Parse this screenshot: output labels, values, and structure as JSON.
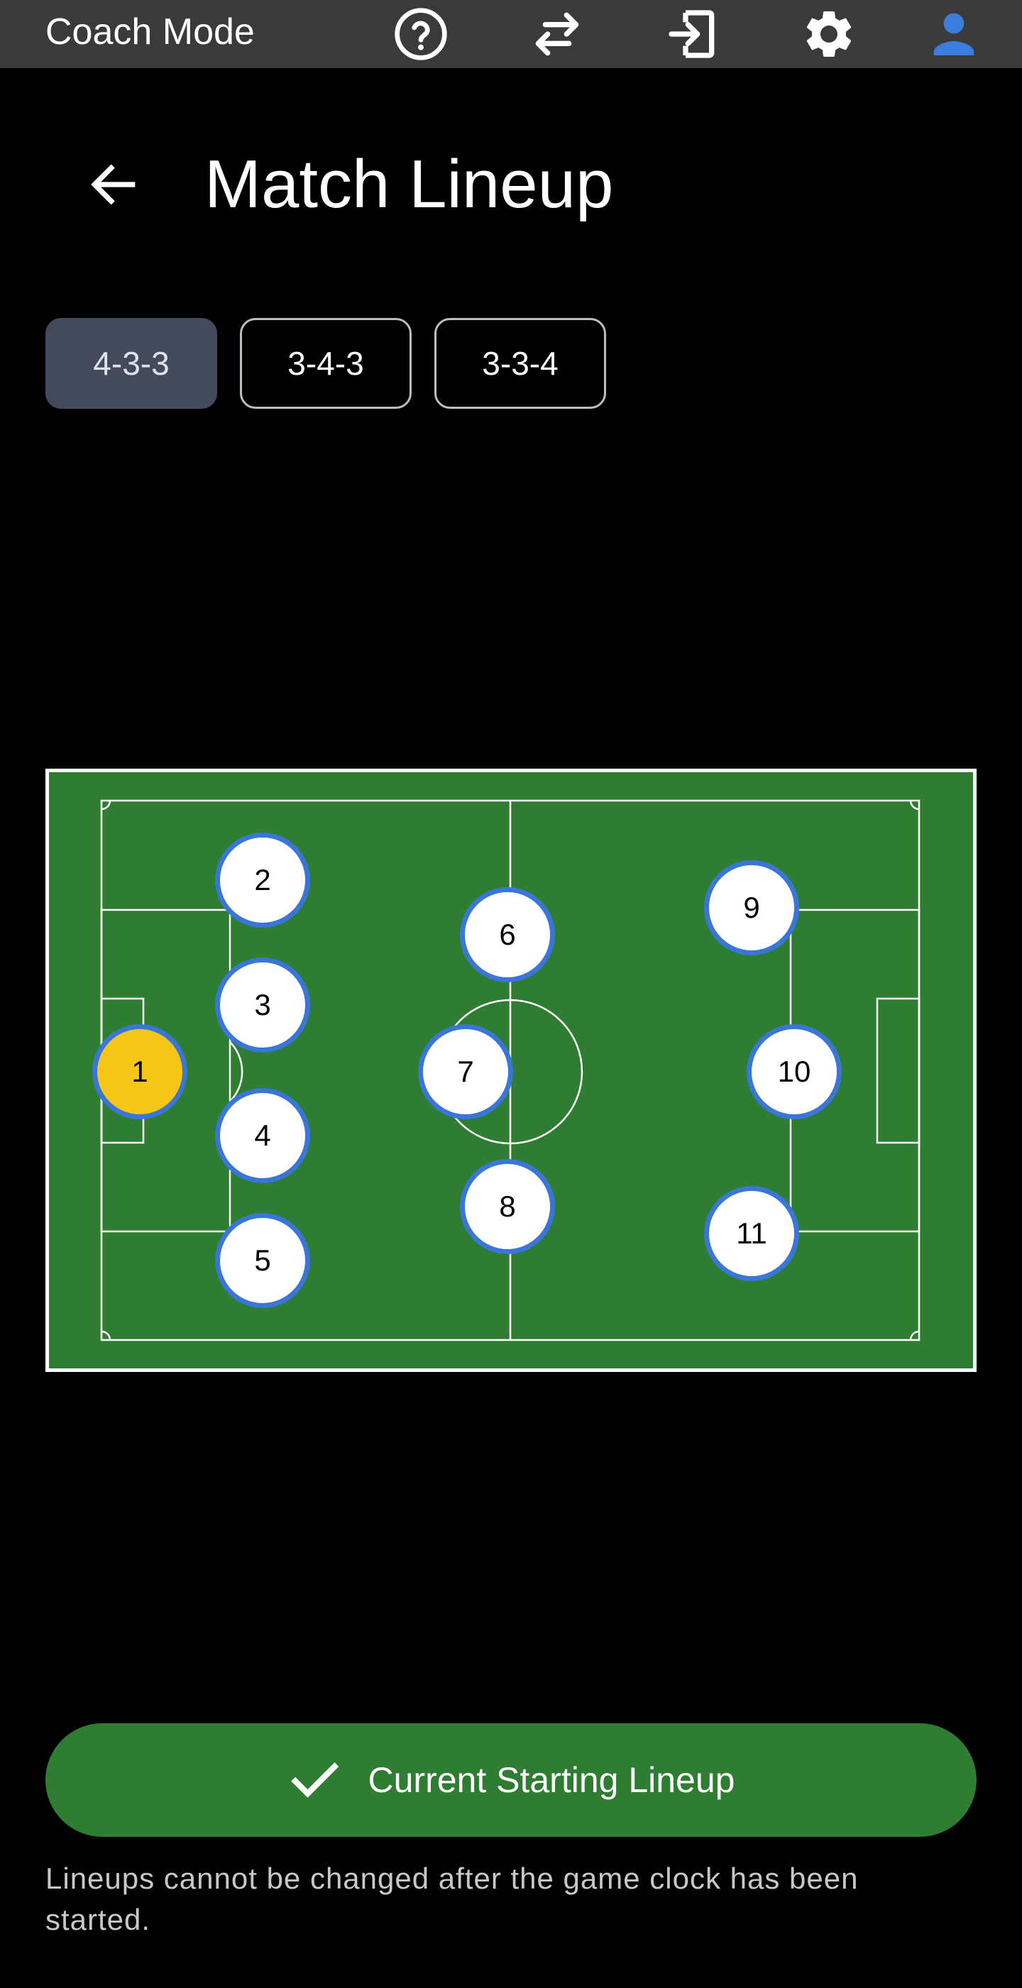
{
  "app_bar": {
    "title": "Coach Mode",
    "icons": [
      "help-icon",
      "swap-icon",
      "exit-icon",
      "settings-icon",
      "account-icon"
    ],
    "account_color": "#3b7ddd"
  },
  "header": {
    "back_icon": "arrow-back-icon",
    "title": "Match Lineup"
  },
  "formations": {
    "selected": "4-3-3",
    "options": [
      "4-3-3",
      "3-4-3",
      "3-3-4"
    ]
  },
  "pitch": {
    "colors": {
      "grass": "#2f7d32",
      "lines": "#ffffff",
      "player_ring": "#3a76d8",
      "goalkeeper": "#f5c518"
    },
    "players": [
      {
        "number": "1",
        "role": "goalkeeper"
      },
      {
        "number": "2",
        "role": "defender"
      },
      {
        "number": "3",
        "role": "defender"
      },
      {
        "number": "4",
        "role": "defender"
      },
      {
        "number": "5",
        "role": "defender"
      },
      {
        "number": "6",
        "role": "midfielder"
      },
      {
        "number": "7",
        "role": "midfielder"
      },
      {
        "number": "8",
        "role": "midfielder"
      },
      {
        "number": "9",
        "role": "forward"
      },
      {
        "number": "10",
        "role": "forward"
      },
      {
        "number": "11",
        "role": "forward"
      }
    ]
  },
  "confirm": {
    "icon": "check-icon",
    "label": "Current Starting Lineup"
  },
  "notice": "Lineups cannot be changed after the game clock has been started."
}
